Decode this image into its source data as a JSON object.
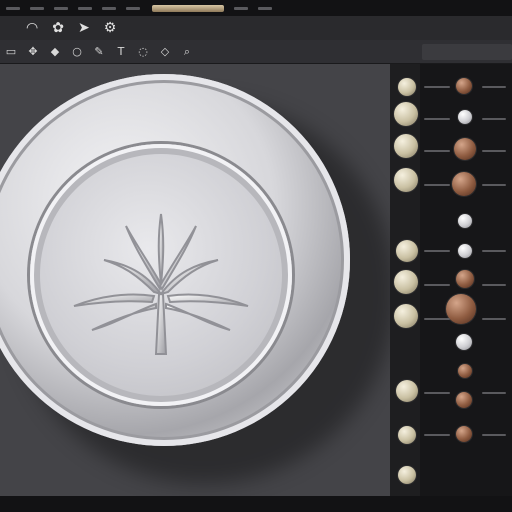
{
  "toolbar_top": {
    "icons": [
      "curve-icon",
      "tree-icon",
      "arrow-icon",
      "gear-icon"
    ]
  },
  "toolbar_secondary": {
    "icons": [
      "select-icon",
      "move-icon",
      "stamp-icon",
      "circle-icon",
      "brush-icon",
      "text-icon",
      "lasso-icon",
      "shape-icon",
      "zoom-icon"
    ]
  },
  "colors": {
    "accent_menu": "#d8c6a4",
    "canvas_bg": "#444448",
    "panel_bg": "#161618"
  }
}
